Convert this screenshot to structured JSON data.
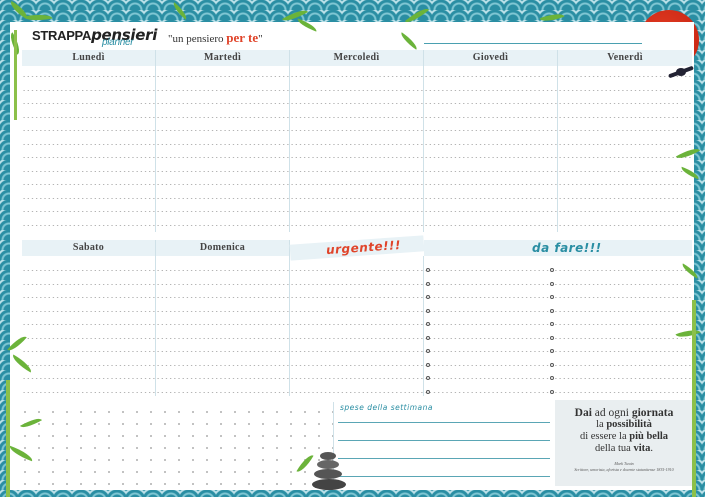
{
  "header": {
    "logo_main": "STRAPPA",
    "logo_script": "pensieri",
    "logo_sub": "planner",
    "tagline_pre": "\"un pensiero",
    "tagline_red": "per te",
    "tagline_post": "\""
  },
  "days_top": [
    "Lunedì",
    "Martedì",
    "Mercoledì",
    "Giovedì",
    "Venerdì"
  ],
  "days_bottom": [
    "Sabato",
    "Domenica"
  ],
  "sections": {
    "urgent": "urgente!!!",
    "todo": "da fare!!!",
    "shopping": "spese della settimana"
  },
  "quote": {
    "l1a": "Dai",
    "l1b": " ad ogni ",
    "l1c": "giornata",
    "l2a": "la ",
    "l2b": "possibilità",
    "l3a": "di essere la ",
    "l3b": "più bella",
    "l4a": "della tua ",
    "l4b": "vita",
    "l4c": ".",
    "author": "Mark Twain",
    "work": "Scrittore, umorista, aforista e docente statunitense 1835-1910"
  },
  "colors": {
    "accent": "#2a8ea3",
    "red": "#e0442a",
    "leaf": "#6bb33a"
  }
}
